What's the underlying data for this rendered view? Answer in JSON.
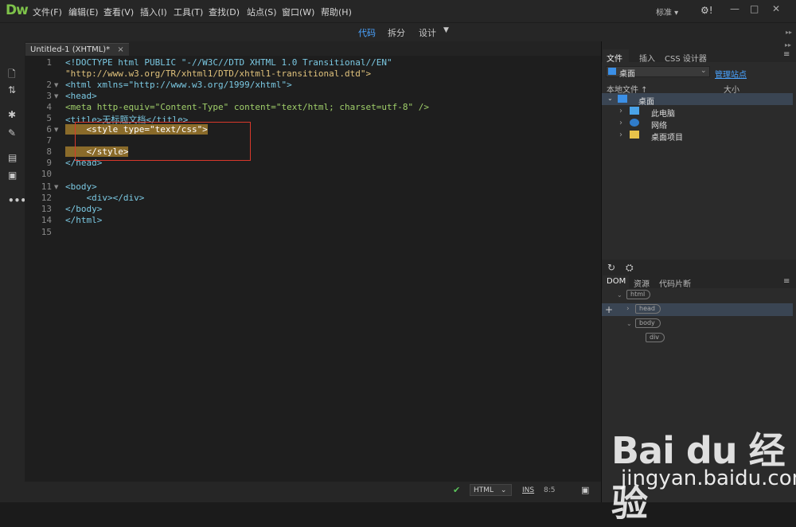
{
  "app": {
    "logo": "Dw"
  },
  "menu": [
    "文件(F)",
    "编辑(E)",
    "查看(V)",
    "插入(I)",
    "工具(T)",
    "查找(D)",
    "站点(S)",
    "窗口(W)",
    "帮助(H)"
  ],
  "workspace": "标准",
  "window_controls": {
    "minimize": "—",
    "maximize": "□",
    "close": "✕"
  },
  "view_modes": {
    "code": "代码",
    "split": "拆分",
    "design": "设计"
  },
  "tab": {
    "title": "Untitled-1 (XHTML)*",
    "close": "×"
  },
  "code_lines": [
    {
      "n": "1",
      "text": "<!DOCTYPE html PUBLIC \"-//W3C//DTD XHTML 1.0 Transitional//EN\""
    },
    {
      "n": "",
      "text": "\"http://www.w3.org/TR/xhtml1/DTD/xhtml1-transitional.dtd\">"
    },
    {
      "n": "2",
      "text": "<html xmlns=\"http://www.w3.org/1999/xhtml\">"
    },
    {
      "n": "3",
      "text": "<head>"
    },
    {
      "n": "4",
      "text": "<meta http-equiv=\"Content-Type\" content=\"text/html; charset=utf-8\" />"
    },
    {
      "n": "5",
      "text": "<title>无标题文档</title>"
    },
    {
      "n": "6",
      "text": "    <style type=\"text/css\">"
    },
    {
      "n": "7",
      "text": ""
    },
    {
      "n": "8",
      "text": "    </style>"
    },
    {
      "n": "9",
      "text": "</head>"
    },
    {
      "n": "10",
      "text": ""
    },
    {
      "n": "11",
      "text": "<body>"
    },
    {
      "n": "12",
      "text": "    <div></div>"
    },
    {
      "n": "13",
      "text": "</body>"
    },
    {
      "n": "14",
      "text": "</html>"
    },
    {
      "n": "15",
      "text": ""
    }
  ],
  "status": {
    "language": "HTML",
    "mode": "INS",
    "position": "8:5"
  },
  "files_panel": {
    "tabs": [
      "文件",
      "插入",
      "CSS 设计器"
    ],
    "site": "桌面",
    "manage_sites": "管理站点",
    "col_local": "本地文件 ↑",
    "col_size": "大小",
    "tree": [
      {
        "label": "桌面",
        "level": 0,
        "expanded": true
      },
      {
        "label": "此电脑",
        "level": 1
      },
      {
        "label": "网络",
        "level": 1
      },
      {
        "label": "桌面项目",
        "level": 1
      }
    ]
  },
  "dom_panel": {
    "tabs": [
      "DOM",
      "资源",
      "代码片断"
    ],
    "nodes": [
      "html",
      "head",
      "body",
      "div"
    ]
  },
  "watermark": {
    "brand": "Bai du 经验",
    "url": "jingyan.baidu.com"
  }
}
